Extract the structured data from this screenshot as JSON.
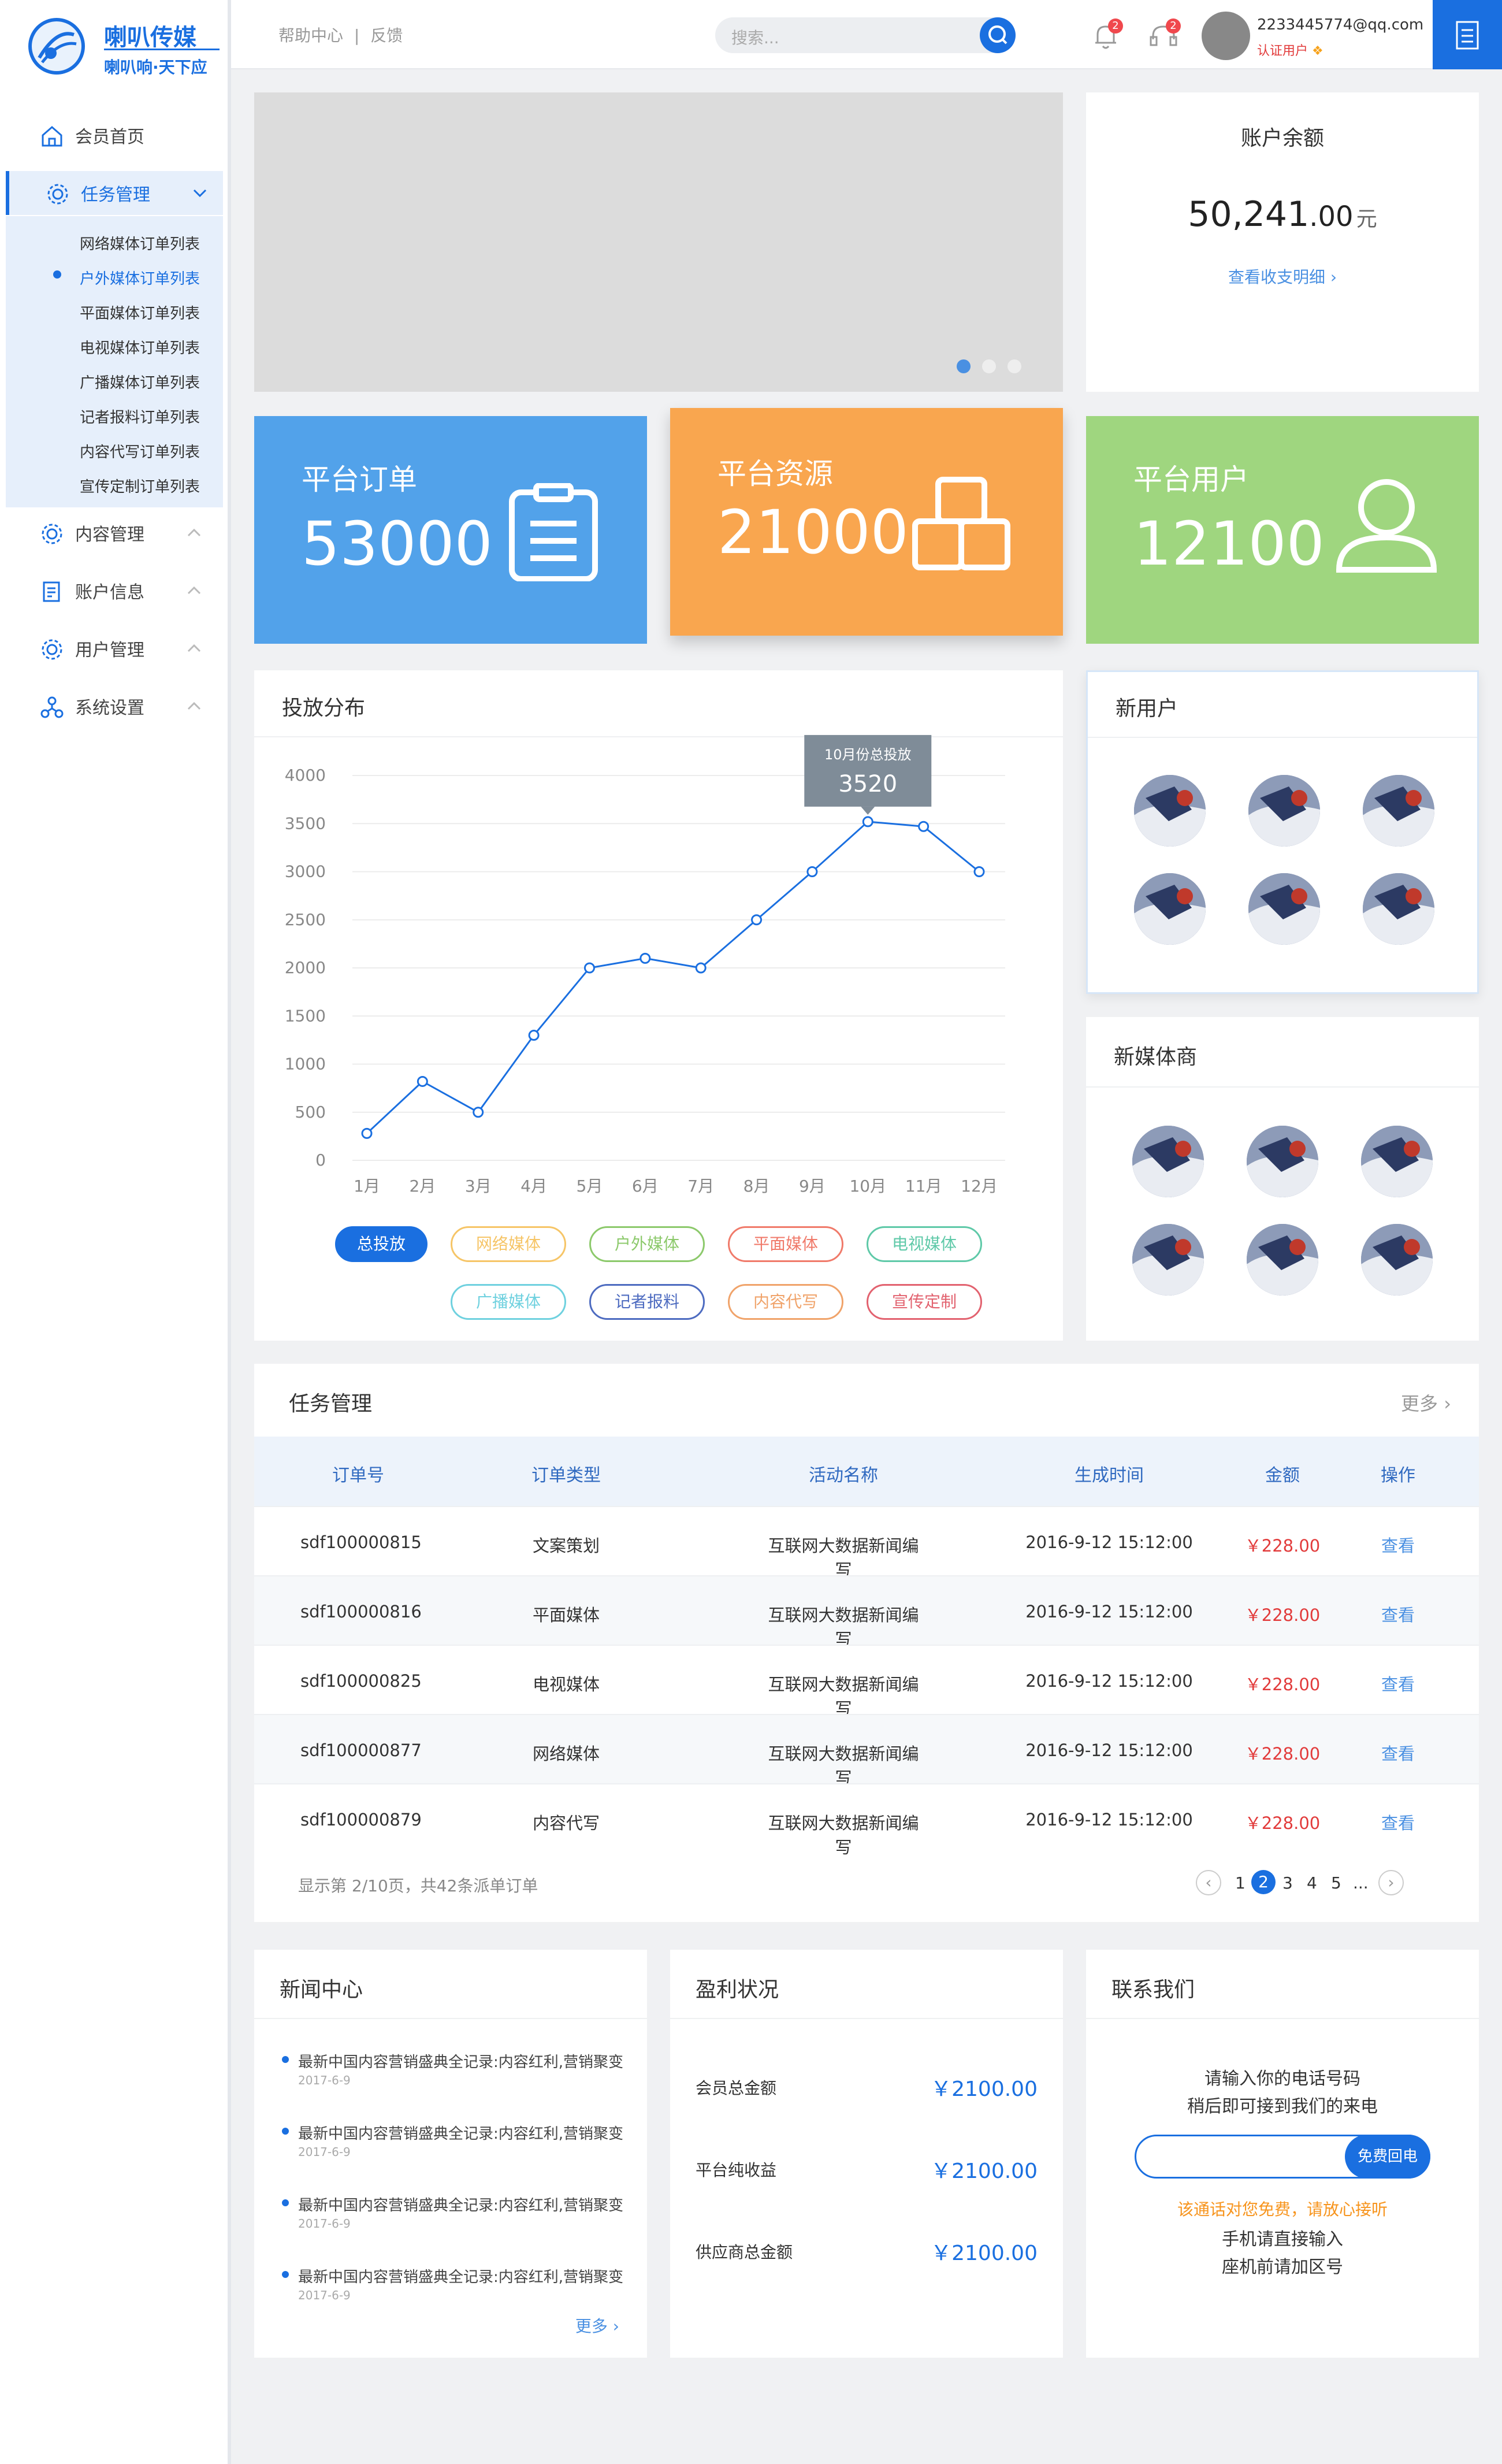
{
  "brand": {
    "name": "喇叭传媒",
    "slogan": "喇叭响·天下应",
    "primary": "#1a6fe0"
  },
  "sidebar": {
    "home": "会员首页",
    "task": "任务管理",
    "sub": [
      "网络媒体订单列表",
      "户外媒体订单列表",
      "平面媒体订单列表",
      "电视媒体订单列表",
      "广播媒体订单列表",
      "记者报料订单列表",
      "内容代写订单列表",
      "宣传定制订单列表"
    ],
    "content": "内容管理",
    "account": "账户信息",
    "users": "用户管理",
    "settings": "系统设置"
  },
  "topbar": {
    "help": "帮助中心",
    "feedback": "反馈",
    "search_placeholder": "搜索...",
    "bell_count": "2",
    "service_count": "2",
    "email": "2233445774@qq.com",
    "cert": "认证用户"
  },
  "balance": {
    "title": "账户余额",
    "amount": "50,241",
    "decimal": ".00",
    "unit": "元",
    "link": "查看收支明细"
  },
  "stats": [
    {
      "label": "平台订单",
      "value": "53000",
      "color": "#52a2ea"
    },
    {
      "label": "平台资源",
      "value": "21000",
      "color": "#f9a64f"
    },
    {
      "label": "平台用户",
      "value": "12100",
      "color": "#9fd67f"
    }
  ],
  "chart": {
    "title": "投放分布",
    "tooltip_label": "10月份总投放",
    "tooltip_value": "3520",
    "filters": [
      {
        "label": "总投放",
        "color": "#1a6fe0",
        "active": true
      },
      {
        "label": "网络媒体",
        "color": "#f6c567"
      },
      {
        "label": "户外媒体",
        "color": "#8cc96b"
      },
      {
        "label": "平面媒体",
        "color": "#f07a6a"
      },
      {
        "label": "电视媒体",
        "color": "#5fc9a8"
      },
      {
        "label": "广播媒体",
        "color": "#6fd1df"
      },
      {
        "label": "记者报料",
        "color": "#4d6bc0"
      },
      {
        "label": "内容代写",
        "color": "#f0a36a"
      },
      {
        "label": "宣传定制",
        "color": "#e2626f"
      }
    ]
  },
  "chart_data": {
    "type": "line",
    "categories": [
      "1月",
      "2月",
      "3月",
      "4月",
      "5月",
      "6月",
      "7月",
      "8月",
      "9月",
      "10月",
      "11月",
      "12月"
    ],
    "yticks": [
      "0",
      "500",
      "1000",
      "1500",
      "2000",
      "2500",
      "3000",
      "3500",
      "4000"
    ],
    "series": [
      {
        "values": [
          280,
          820,
          500,
          1300,
          2000,
          2100,
          2000,
          2500,
          3000,
          3520,
          3470,
          3000
        ]
      }
    ],
    "ylim": [
      0,
      4000
    ],
    "color": "#1a6fe0",
    "grid": true
  },
  "newusers": {
    "title": "新用户"
  },
  "newmedia": {
    "title": "新媒体商"
  },
  "tasks": {
    "title": "任务管理",
    "more": "更多",
    "headers": [
      "订单号",
      "订单类型",
      "活动名称",
      "生成时间",
      "金额",
      "操作"
    ],
    "rows": [
      [
        "sdf100000815",
        "文案策划",
        "互联网大数据新闻编写",
        "2016-9-12 15:12:00",
        "￥228.00",
        "查看"
      ],
      [
        "sdf100000816",
        "平面媒体",
        "互联网大数据新闻编写",
        "2016-9-12 15:12:00",
        "￥228.00",
        "查看"
      ],
      [
        "sdf100000825",
        "电视媒体",
        "互联网大数据新闻编写",
        "2016-9-12 15:12:00",
        "￥228.00",
        "查看"
      ],
      [
        "sdf100000877",
        "网络媒体",
        "互联网大数据新闻编写",
        "2016-9-12 15:12:00",
        "￥228.00",
        "查看"
      ],
      [
        "sdf100000879",
        "内容代写",
        "互联网大数据新闻编写",
        "2016-9-12 15:12:00",
        "￥228.00",
        "查看"
      ]
    ],
    "footer": "显示第 2/10页，共42条派单订单",
    "pages": [
      "1",
      "2",
      "3",
      "4",
      "5",
      "..."
    ]
  },
  "news": {
    "title": "新闻中心",
    "items": [
      {
        "text": "最新中国内容营销盛典全记录:内容红利,营销聚变",
        "date": "2017-6-9"
      },
      {
        "text": "最新中国内容营销盛典全记录:内容红利,营销聚变",
        "date": "2017-6-9"
      },
      {
        "text": "最新中国内容营销盛典全记录:内容红利,营销聚变",
        "date": "2017-6-9"
      },
      {
        "text": "最新中国内容营销盛典全记录:内容红利,营销聚变",
        "date": "2017-6-9"
      }
    ],
    "more": "更多"
  },
  "profit": {
    "title": "盈利状况",
    "items": [
      {
        "label": "会员总金额",
        "value": "￥2100.00"
      },
      {
        "label": "平台纯收益",
        "value": "￥2100.00"
      },
      {
        "label": "供应商总金额",
        "value": "￥2100.00"
      }
    ]
  },
  "contact": {
    "title": "联系我们",
    "line1": "请输入你的电话号码",
    "line2": "稍后即可接到我们的来电",
    "button": "免费回电",
    "free": "该通话对您免费，请放心接听",
    "note1": "手机请直接输入",
    "note2": "座机前请加区号"
  }
}
